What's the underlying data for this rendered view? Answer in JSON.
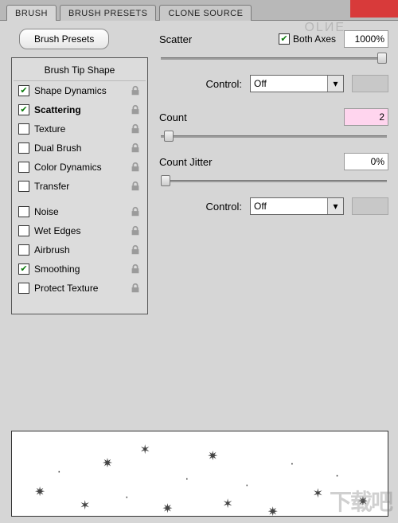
{
  "tabs": {
    "brush": "BRUSH",
    "presets": "BRUSH PRESETS",
    "clone": "CLONE SOURCE"
  },
  "left": {
    "presets_btn": "Brush Presets",
    "header": "Brush Tip Shape",
    "items": [
      {
        "label": "Shape Dynamics",
        "checked": true,
        "lock": true
      },
      {
        "label": "Scattering",
        "checked": true,
        "lock": true,
        "selected": true
      },
      {
        "label": "Texture",
        "checked": false,
        "lock": true
      },
      {
        "label": "Dual Brush",
        "checked": false,
        "lock": true
      },
      {
        "label": "Color Dynamics",
        "checked": false,
        "lock": true
      },
      {
        "label": "Transfer",
        "checked": false,
        "lock": true
      }
    ],
    "items2": [
      {
        "label": "Noise",
        "checked": false,
        "lock": true
      },
      {
        "label": "Wet Edges",
        "checked": false,
        "lock": true
      },
      {
        "label": "Airbrush",
        "checked": false,
        "lock": true
      },
      {
        "label": "Smoothing",
        "checked": true,
        "lock": true
      },
      {
        "label": "Protect Texture",
        "checked": false,
        "lock": true
      }
    ]
  },
  "right": {
    "scatter_label": "Scatter",
    "both_axes_label": "Both Axes",
    "both_axes_checked": true,
    "scatter_value": "1000%",
    "control_label": "Control:",
    "control1_value": "Off",
    "count_label": "Count",
    "count_value": "2",
    "count_jitter_label": "Count Jitter",
    "count_jitter_value": "0%",
    "control2_value": "Off"
  },
  "watermark": "下载吧"
}
